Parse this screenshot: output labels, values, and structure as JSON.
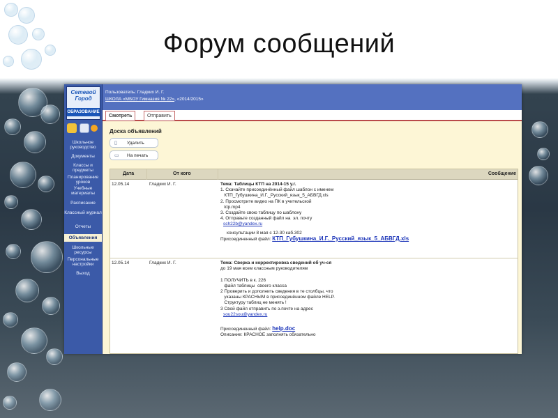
{
  "slide": {
    "title": "Форум сообщений"
  },
  "app": {
    "logo": {
      "line1": "Сетевой",
      "line2": "Город",
      "line3": "ОБРАЗОВАНИЕ"
    },
    "header": {
      "user": "Пользователь: Гладких И. Г.",
      "school": "ШКОЛА «МБОУ Гимназия № 22»",
      "year": ", «2014/2015»"
    },
    "sidebar": {
      "items": [
        {
          "label": "Школьное руководство"
        },
        {
          "label": "Документы"
        },
        {
          "label": "Классы и предметы"
        },
        {
          "label": "Планирование уроков"
        },
        {
          "label": "Учебные материалы"
        },
        {
          "label": "Расписание"
        },
        {
          "label": "Классный журнал"
        },
        {
          "label": "Отчеты"
        },
        {
          "label": "Объявления"
        },
        {
          "label": "Школьные ресурсы"
        },
        {
          "label": "Персональные настройки"
        },
        {
          "label": "Выход"
        }
      ]
    },
    "tabs": [
      {
        "label": "Смотреть"
      },
      {
        "label": "Отправить"
      }
    ],
    "board": {
      "title": "Доска объявлений",
      "delete_label": "Удалить",
      "print_label": "На печать"
    },
    "table": {
      "headers": {
        "date": "Дата",
        "from": "От кого",
        "message": "Сообщение"
      },
      "rows": [
        {
          "date": "12.05.14",
          "from": "Гладких И. Г.",
          "topic": "Тема: Таблицы КТП на 2014-15 у.г.",
          "body": "1. Скачайте присоединённый файл шаблон с именем\n   КТП_Губушкина_И.Г._Русский_язык_5_АБВГД.xls\n2. Просмотрите видео на ПК в учительской\n   ktp.mp4\n3. Создайте свою таблицу по шаблону\n4. Отправьте созданный файл на  эл. почту",
          "email": "sch22b@yandex.ru",
          "note": "     консультации 8 мая с 12-30 каб.302",
          "attach_label": "Присоединенный файл:",
          "attach_file": "КТП_Губушкина_И.Г._Русский_язык_5_АБВГД.xls"
        },
        {
          "date": "12.05.14",
          "from": "Гладких И. Г.",
          "topic": "Тема: Сверка и корректировка сведений об уч-ся",
          "body": "до 19 мая всем классным руководителям\n\n1 ПОЛУЧИТЬ в к. 226\n   файл таблицы  своего класса\n2 Проверить и дополнить сведения в те столбцы, что\n   указаны КРАСНЫМ в присоединённом файле HELP.\n   Структуру таблиц не менять !\n3 Свой файл отправить по э.почте на адрес",
          "email": "sou22sou@yandex.ru",
          "attach_label": "Присоединенный файл:",
          "attach_file": "help.doc",
          "description": "Описание: КРАСНОЕ заполнять обязательно"
        }
      ]
    }
  },
  "colors": {
    "sidebar": "#3b5aa8",
    "header": "#5471c0",
    "content_bg": "#fdf6d6",
    "tab_border": "#b94a4a",
    "link": "#1a33b8"
  }
}
